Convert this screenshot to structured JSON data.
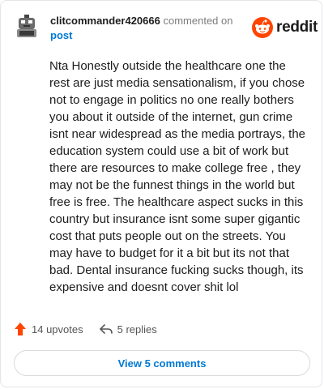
{
  "header": {
    "username": "clitcommander420666",
    "action": "commented on",
    "link": "post"
  },
  "brand": {
    "wordmark": "reddit",
    "icon": "reddit-alien-icon",
    "color": "#ff4500"
  },
  "comment": {
    "body": "Nta Honestly outside the healthcare one the rest are just media sensationalism, if you chose not to engage in politics no one really bothers you about it outside of the internet, gun crime isnt near widespread as the media portrays, the education system could use a bit of work but there are resources to make college free , they may not be the funnest things in the world but free is free. The healthcare aspect sucks in this country but insurance isnt some super gigantic cost that puts people out on the streets. You may have to budget for it a bit but its not that bad. Dental insurance fucking sucks though, its expensive and doesnt cover shit lol"
  },
  "footer": {
    "upvotes": "14 upvotes",
    "replies": "5 replies",
    "upvote_icon": "upvote-arrow-icon",
    "reply_icon": "reply-arrow-icon"
  },
  "button": {
    "label": "View 5 comments",
    "color": "#0079d3"
  }
}
